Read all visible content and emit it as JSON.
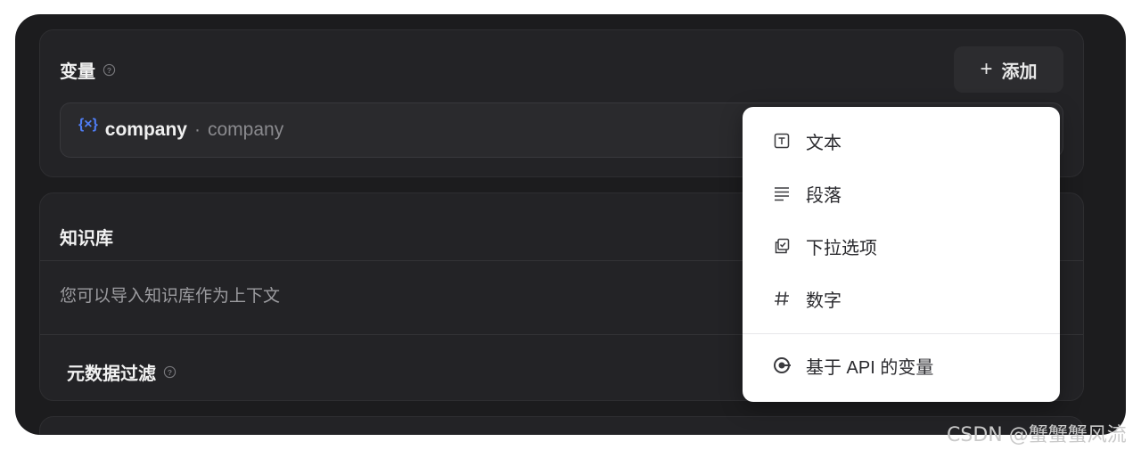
{
  "variables": {
    "title": "变量",
    "add_label": "添加",
    "items": [
      {
        "name": "company",
        "label": "company"
      }
    ]
  },
  "knowledge": {
    "title": "知识库",
    "description": "您可以导入知识库作为上下文",
    "metadata_filter_label": "元数据过滤"
  },
  "menu": {
    "items": [
      {
        "icon": "text-box-icon",
        "label": "文本"
      },
      {
        "icon": "paragraph-icon",
        "label": "段落"
      },
      {
        "icon": "dropdown-options-icon",
        "label": "下拉选项"
      },
      {
        "icon": "hash-icon",
        "label": "数字"
      }
    ],
    "api_item": {
      "icon": "api-icon",
      "label": "基于 API 的变量"
    }
  },
  "watermark": "CSDN @蟹蟹蟹风流"
}
